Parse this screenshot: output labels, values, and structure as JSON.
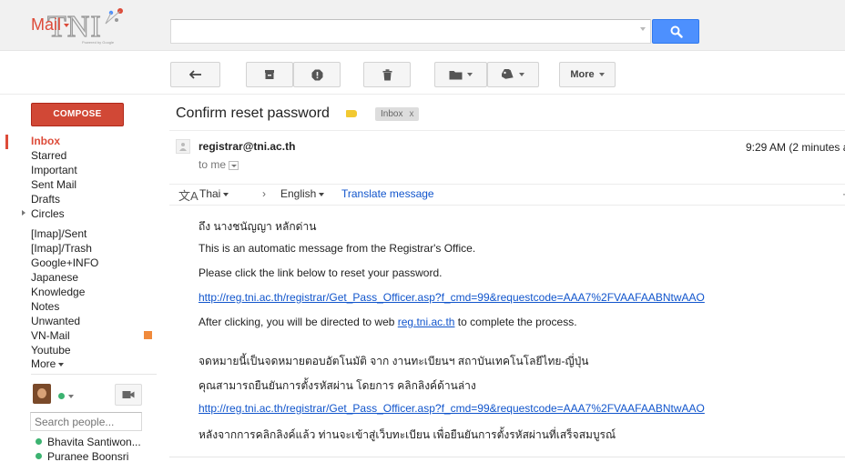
{
  "header": {
    "logo_text": "TNI",
    "logo_powered": "Powered by Google",
    "search": {
      "value": "",
      "placeholder": ""
    }
  },
  "mail_menu": {
    "label": "Mail"
  },
  "toolbar": {
    "more_label": "More"
  },
  "compose": {
    "label": "COMPOSE"
  },
  "nav": {
    "items": [
      {
        "label": "Inbox",
        "active": true
      },
      {
        "label": "Starred"
      },
      {
        "label": "Important"
      },
      {
        "label": "Sent Mail"
      },
      {
        "label": "Drafts"
      },
      {
        "label": "Circles"
      },
      {
        "label": "[Imap]/Sent"
      },
      {
        "label": "[Imap]/Trash"
      },
      {
        "label": "Google+INFO"
      },
      {
        "label": "Japanese"
      },
      {
        "label": "Knowledge"
      },
      {
        "label": "Notes"
      },
      {
        "label": "Unwanted"
      },
      {
        "label": "VN-Mail",
        "swatch": "#f08a3c"
      },
      {
        "label": "Youtube"
      },
      {
        "label": "More"
      }
    ]
  },
  "chat": {
    "search_placeholder": "Search people...",
    "contacts": [
      {
        "name": "Bhavita Santiwon...",
        "status": "online"
      },
      {
        "name": "Puranee Boonsri",
        "status": "online"
      }
    ]
  },
  "message": {
    "subject": "Confirm reset password",
    "label_chip": "Inbox",
    "label_chip_close": "x",
    "sender": "registrar@tni.ac.th",
    "time": "9:29 AM (2 minutes a",
    "to_me": "to me",
    "translate": {
      "icon_glyph": "文A",
      "from": "Thai",
      "arrow": "›",
      "to": "English",
      "action": "Translate message"
    },
    "body": {
      "greeting": "ถึง นางชนัญญา หลักด่าน",
      "line1": "This is an automatic message from the Registrar's Office.",
      "line2": "Please click the link below to reset your password.",
      "link": "http://reg.tni.ac.th/registrar/Get_Pass_Officer.asp?f_cmd=99&requestcode=AAA7%2FVAAFAABNtwAAO",
      "after_pre": "After clicking, you will be directed to web ",
      "after_link": "reg.tni.ac.th",
      "after_post": " to complete the process.",
      "thai1": "จดหมายนี้เป็นจดหมายตอบอัตโนมัติ จาก งานทะเบียนฯ สถาบันเทคโนโลยีไทย-ญี่ปุ่น",
      "thai2": "คุณสามารถยืนยันการตั้งรหัสผ่าน โดยการ คลิกลิงค์ด้านล่าง",
      "link2": "http://reg.tni.ac.th/registrar/Get_Pass_Officer.asp?f_cmd=99&requestcode=AAA7%2FVAAFAABNtwAAO",
      "thai3": "หลังจากการคลิกลิงค์แล้ว ท่านจะเข้าสู่เว็บทะเบียน เพื่อยืนยันการตั้งรหัสผ่านที่เสร็จสมบูรณ์"
    }
  },
  "colors": {
    "accent_red": "#dd4b39",
    "compose_red": "#d14836",
    "search_blue": "#4d90fe",
    "link_blue": "#1155cc",
    "label_yellow": "#f2c931"
  }
}
